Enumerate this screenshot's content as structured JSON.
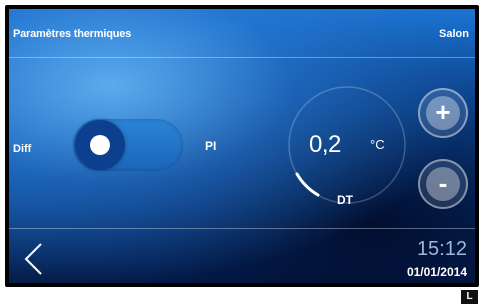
{
  "header": {
    "title": "Paramètres thermiques",
    "room": "Salon"
  },
  "controls": {
    "diff_label": "Diff",
    "pi_label": "PI",
    "value": "0,2",
    "unit": "°C",
    "mode": "DT",
    "plus": "+",
    "minus": "-"
  },
  "footer": {
    "time": "15:12",
    "date": "01/01/2014"
  },
  "badge": "L",
  "icons": {
    "back": "chevron-left-icon",
    "plus": "plus-icon",
    "minus": "minus-icon"
  }
}
